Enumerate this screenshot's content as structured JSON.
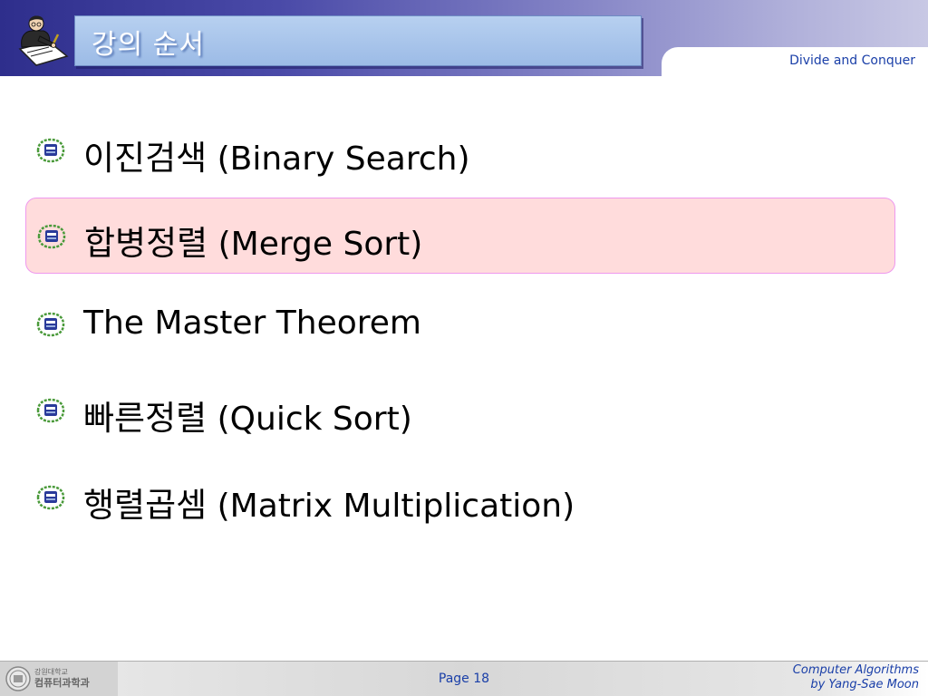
{
  "header": {
    "title": "강의 순서",
    "subtitle": "Divide and Conquer"
  },
  "agenda": {
    "items": [
      {
        "ko": "이진검색",
        "en": "(Binary Search)",
        "highlighted": false
      },
      {
        "ko": "합병정렬",
        "en": "(Merge Sort)",
        "highlighted": true
      },
      {
        "ko": "",
        "en": "The Master Theorem",
        "highlighted": false
      },
      {
        "ko": "빠른정렬",
        "en": "(Quick Sort)",
        "highlighted": false
      },
      {
        "ko": "행렬곱셈",
        "en": "(Matrix Multiplication)",
        "highlighted": false
      }
    ]
  },
  "footer": {
    "dept_line1": "강원대학교",
    "dept_line2": "컴퓨터과학과",
    "page": "Page 18",
    "course": "Computer Algorithms",
    "author": "by Yang-Sae Moon"
  },
  "colors": {
    "header_dark": "#2e2e8c",
    "title_bar": "#9cbbe6",
    "accent_text": "#1a3fa8",
    "highlight_fill": "#ffdcdc",
    "highlight_border": "#ee99ee",
    "emblem_blue": "#2a3a9a",
    "emblem_green": "#4a9a3a"
  },
  "icons": {
    "header_logo": "professor-writing-icon",
    "bullet": "university-emblem-icon",
    "footer_seal": "university-seal-icon"
  }
}
